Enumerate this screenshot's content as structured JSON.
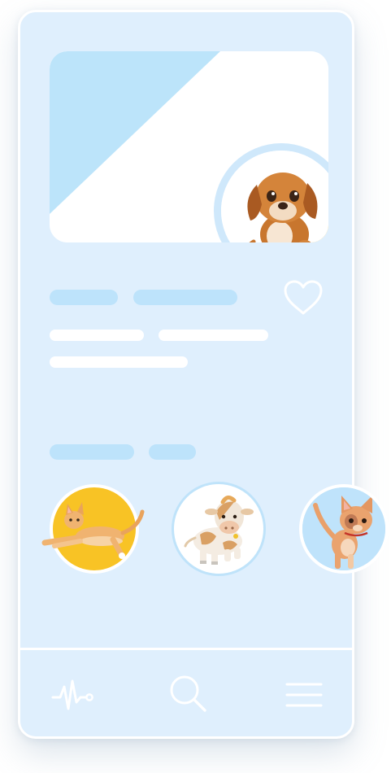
{
  "hero": {
    "featured_pet_icon": "puppy-icon",
    "colors": {
      "card_bg": "#ffffff",
      "triangle": "#bce4fa",
      "accent": "#f8bd1a"
    }
  },
  "details": {
    "favorite_icon": "heart-icon"
  },
  "pets": [
    {
      "icon": "cat-lying-icon",
      "bg": "#f8c325"
    },
    {
      "icon": "cow-icon",
      "bg": "#ffffff"
    },
    {
      "icon": "cat-standing-icon",
      "bg": "#bfe3fb"
    }
  ],
  "tab_bar": {
    "items": [
      {
        "icon": "activity-pulse-icon"
      },
      {
        "icon": "search-icon"
      },
      {
        "icon": "menu-icon"
      }
    ]
  },
  "theme": {
    "screen_bg": "#dfeffd",
    "placeholder_blue": "#bde3fb",
    "placeholder_white": "#ffffff"
  }
}
